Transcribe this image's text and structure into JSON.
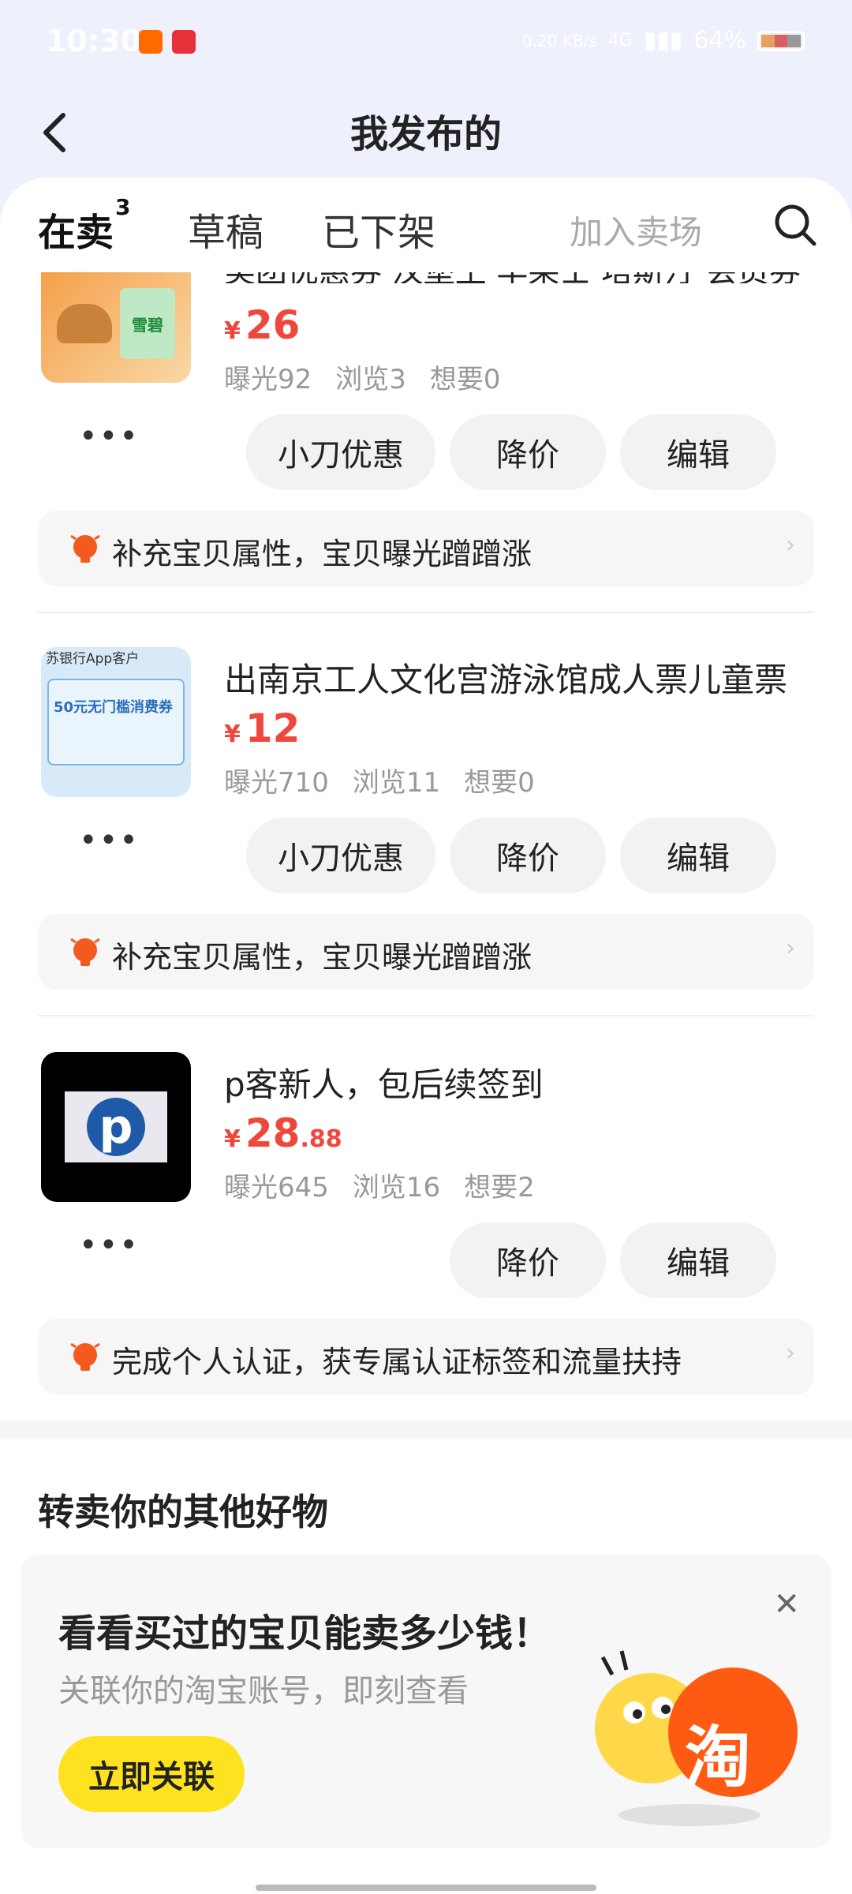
{
  "status": {
    "time": "10:30",
    "net_speed": "0.20 KB/s",
    "network": "4G",
    "battery": "64%"
  },
  "header": {
    "title": "我发布的"
  },
  "tabs": {
    "active": "在卖",
    "active_count": "3",
    "drafts": "草稿",
    "removed": "已下架",
    "join_market": "加入卖场"
  },
  "items": [
    {
      "title": "美团优惠券 汉堡王 华莱士 塔斯汀 会员券，可",
      "price_int": "26",
      "price_dec": "",
      "views_exposure": "曝光92",
      "views_browse": "浏览3",
      "wants": "想要0",
      "btn_discount": "小刀优惠",
      "btn_reduce": "降价",
      "btn_edit": "编辑",
      "tip": "补充宝贝属性，宝贝曝光蹭蹭涨",
      "thumb_label": "雪碧"
    },
    {
      "title": "出南京工人文化宫游泳馆成人票儿童票",
      "price_int": "12",
      "price_dec": "",
      "views_exposure": "曝光710",
      "views_browse": "浏览11",
      "wants": "想要0",
      "btn_discount": "小刀优惠",
      "btn_reduce": "降价",
      "btn_edit": "编辑",
      "tip": "补充宝贝属性，宝贝曝光蹭蹭涨",
      "thumb_header": "苏银行App客户",
      "thumb_label": "50元无门槛消费券"
    },
    {
      "title": "p客新人，包后续签到",
      "price_int": "28",
      "price_dec": ".88",
      "views_exposure": "曝光645",
      "views_browse": "浏览16",
      "wants": "想要2",
      "btn_reduce": "降价",
      "btn_edit": "编辑",
      "tip": "完成个人认证，获专属认证标签和流量扶持",
      "thumb_label": "p"
    }
  ],
  "currency": "¥",
  "other": {
    "title": "转卖你的其他好物",
    "promo_title": "看看买过的宝贝能卖多少钱！",
    "promo_sub": "关联你的淘宝账号，即刻查看",
    "promo_btn": "立即关联",
    "mascot_badge": "淘"
  },
  "colors": {
    "price": "#f0473d",
    "accent_yellow": "#ffe21f",
    "tip_icon": "#f35a1f",
    "header_bg": "#eef0fb"
  }
}
